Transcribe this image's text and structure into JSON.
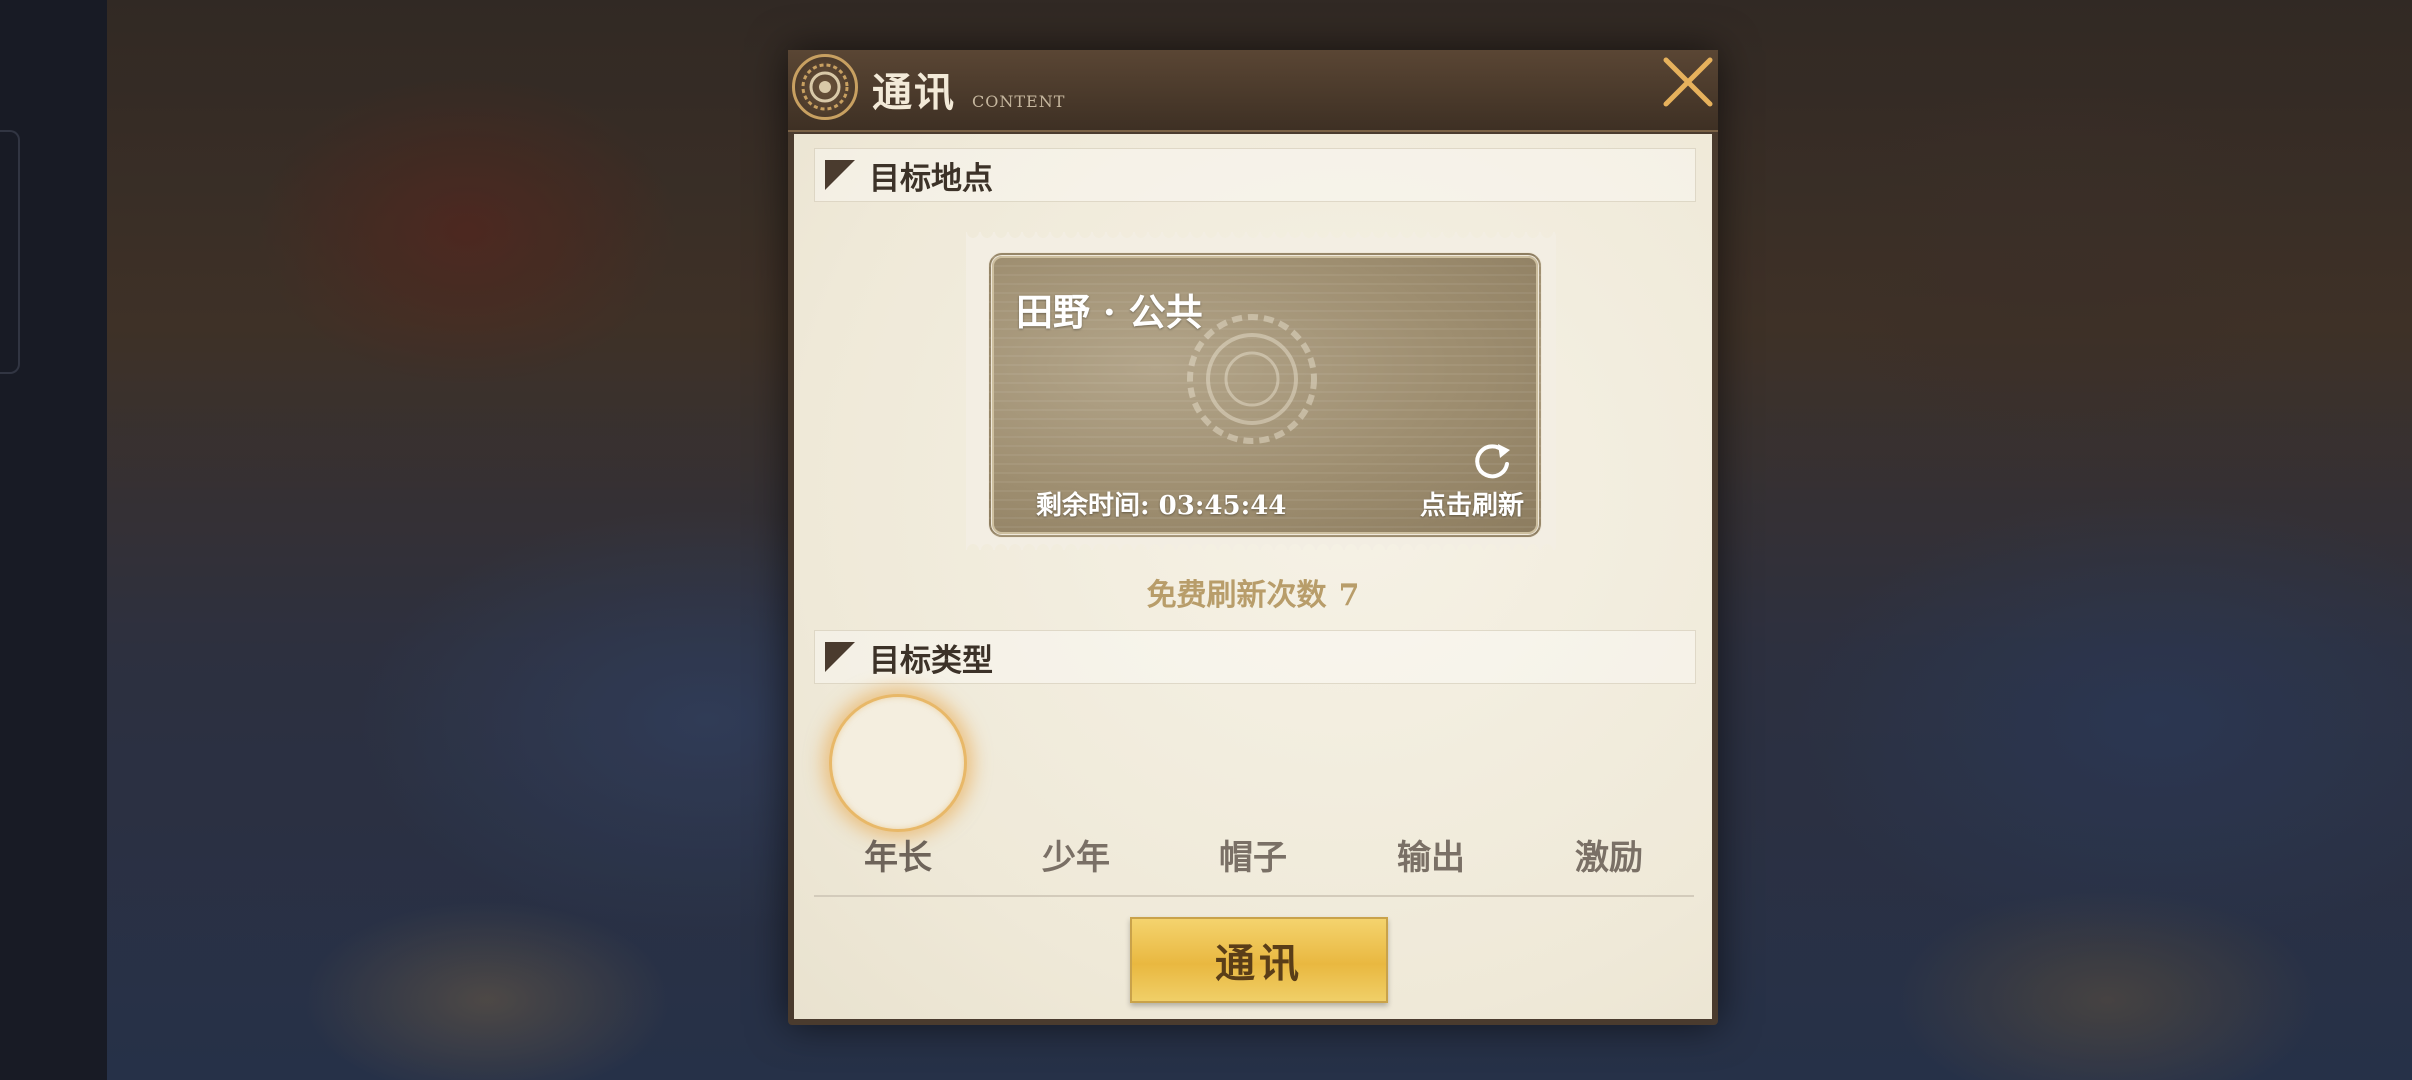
{
  "dialog": {
    "title": "通讯",
    "subtitle": "CONTENT"
  },
  "location_section": {
    "heading": "目标地点",
    "card": {
      "place": "田野 · 公共",
      "timer_text": "剩余时间: 03:45:44",
      "refresh_label": "点击刷新"
    },
    "free_refresh_label": "免费刷新次数",
    "free_refresh_count": "7"
  },
  "type_section": {
    "heading": "目标类型",
    "options": [
      {
        "label": "年长",
        "selected": true
      },
      {
        "label": "少年",
        "selected": false
      },
      {
        "label": "帽子",
        "selected": false
      },
      {
        "label": "输出",
        "selected": false
      },
      {
        "label": "激励",
        "selected": false
      }
    ]
  },
  "action_button": "通讯",
  "icons": {
    "badge": "gear-icon",
    "close": "close-icon",
    "refresh": "refresh-icon"
  },
  "colors": {
    "accent_gold": "#e9b840",
    "panel_dark": "#4a3b2e",
    "panel_light": "#f3eee3"
  }
}
